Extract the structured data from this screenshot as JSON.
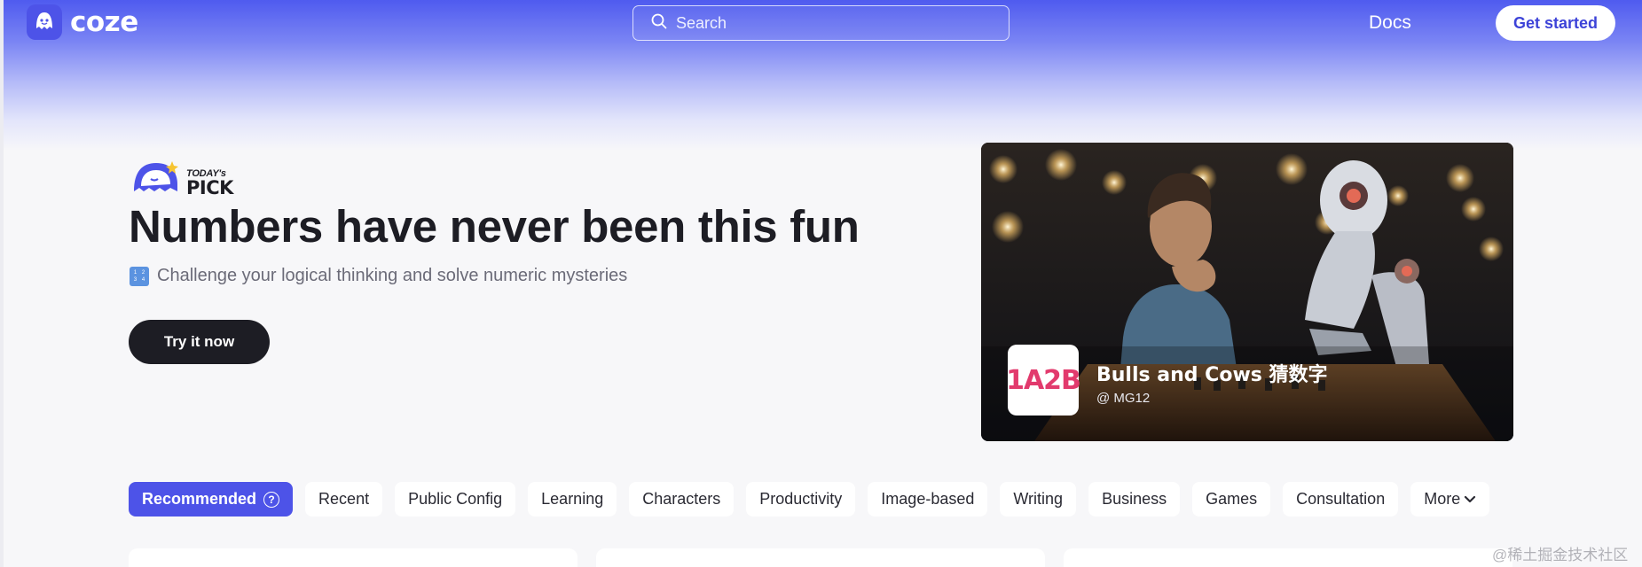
{
  "header": {
    "logo_text": "coze",
    "search_placeholder": "Search",
    "docs_label": "Docs",
    "get_started_label": "Get started"
  },
  "hero": {
    "badge_small": "TODAY's",
    "badge_big": "PICK",
    "title": "Numbers have never been this fun",
    "subtitle": "Challenge your logical thinking and solve numeric mysteries",
    "cta_label": "Try it now"
  },
  "featured_bot": {
    "badge_text": "1A2B",
    "name": "Bulls and Cows 猜数字",
    "author": "@ MG12"
  },
  "tabs": [
    {
      "label": "Recommended",
      "active": true
    },
    {
      "label": "Recent"
    },
    {
      "label": "Public Config"
    },
    {
      "label": "Learning"
    },
    {
      "label": "Characters"
    },
    {
      "label": "Productivity"
    },
    {
      "label": "Image-based"
    },
    {
      "label": "Writing"
    },
    {
      "label": "Business"
    },
    {
      "label": "Games"
    },
    {
      "label": "Consultation"
    },
    {
      "label": "More"
    }
  ],
  "watermark": "@稀土掘金技术社区",
  "colors": {
    "brand": "#4d53e8",
    "dark_button": "#1d1d24",
    "badge_red": "#e23a6d"
  }
}
